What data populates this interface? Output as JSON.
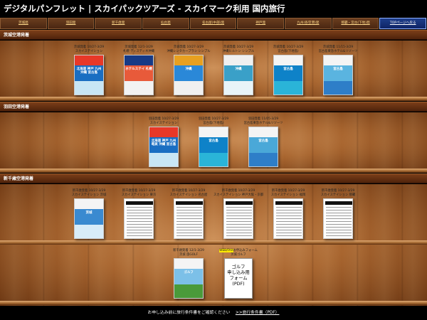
{
  "title": "デジタルパンフレット | スカイパックツアーズ - スカイマーク利用 国内旅行",
  "nav": [
    "茨城発",
    "羽田発",
    "新千歳発",
    "仙台発",
    "名古屋(中部)発",
    "神戸発",
    "九州(各空港)発",
    "那覇・宮古(下地)発",
    "TOPページへ戻る"
  ],
  "sections": [
    {
      "header": "茨城空港発着",
      "books": [
        {
          "label1": "茨城発着 10/27-3/29",
          "label2": "スカイステイション",
          "cover": {
            "top": "#e83828",
            "mid": "#1a6ec2",
            "bottom": "#c8e6f5",
            "text": "北海道 神戸 九州 沖縄 宮古島"
          }
        },
        {
          "label1": "茨城発着 12/1-3/29",
          "label2": "札幌 ディスティネ沖縄",
          "cover": {
            "top": "#163a86",
            "mid": "#e85a3a",
            "bottom": "#f2f2f2",
            "text": "ホテルステイ 札幌"
          }
        },
        {
          "label1": "茨城発着 10/27-3/29",
          "label2": "沖縄レンタカープラン シンプル",
          "cover": {
            "top": "#e8a020",
            "mid": "#2a88d8",
            "bottom": "#f0f0f0",
            "text": "沖縄"
          }
        },
        {
          "label1": "茨城発着 10/27-3/29",
          "label2": "沖縄ヒルトン シンプル",
          "cover": {
            "top": "#f0f0f0",
            "mid": "#3aa0c8",
            "bottom": "#e8f4f8",
            "text": "沖縄"
          }
        },
        {
          "label1": "茨城発着 10/27-3/29",
          "label2": "宮古島(下地島)",
          "cover": {
            "top": "#f4f4f4",
            "mid": "#0e82c8",
            "bottom": "#2ab4d8",
            "text": "宮古島"
          }
        },
        {
          "label1": "茨城発着 11/15-3/29",
          "label2": "宮古島東急ホテル&リゾーツ",
          "cover": {
            "top": "#f4f4f4",
            "mid": "#5ab4e0",
            "bottom": "#2e7ec8",
            "text": "宮古島"
          }
        }
      ]
    },
    {
      "header": "羽田空港発着",
      "books": [
        {
          "label1": "羽田発着 10/27-3/29",
          "label2": "スカイステイション",
          "cover": {
            "top": "#e83828",
            "mid": "#1a6ec2",
            "bottom": "#c8e6f5",
            "text": "北海道 神戸 九州 奄美 沖縄 宮古島"
          }
        },
        {
          "label1": "羽田発着 10/27-3/29",
          "label2": "宮古島(下地島)",
          "cover": {
            "top": "#f4f4f4",
            "mid": "#0e82c8",
            "bottom": "#2ab4d8",
            "text": "宮古島"
          }
        },
        {
          "label1": "羽田発着 11/05-3/29",
          "label2": "宮古島東急ホテル&リゾーツ",
          "cover": {
            "top": "#f4f4f4",
            "mid": "#4aa8d8",
            "bottom": "#2e7ec8",
            "text": "宮古島"
          }
        }
      ]
    },
    {
      "header": "新千歳空港発着",
      "books": [
        {
          "label1": "新千歳発着 10/27-3/29",
          "label2": "スカイステイション 茨城",
          "cover": {
            "top": "#f4f4f4",
            "mid": "#3a8ad0",
            "bottom": "#d8ecf8",
            "text": "茨城"
          }
        },
        {
          "label1": "新千歳発着 10/27-3/29",
          "label2": "スカイステイション 東京",
          "cover": {
            "doc": true
          }
        },
        {
          "label1": "新千歳発着 10/27-3/29",
          "label2": "スカイステイション 名古屋",
          "cover": {
            "doc": true
          }
        },
        {
          "label1": "新千歳発着 10/27-3/29",
          "label2": "スカイステイション 神戸大阪・京都",
          "cover": {
            "doc": true
          }
        },
        {
          "label1": "新千歳発着 10/27-3/29",
          "label2": "スカイステイション 福岡",
          "cover": {
            "doc": true
          }
        },
        {
          "label1": "新千歳発着 10/27-3/29",
          "label2": "スカイステイション 那覇",
          "cover": {
            "doc": true
          }
        }
      ]
    },
    {
      "header": "",
      "books": [
        {
          "label1": "新千歳発着 12/1-3/29",
          "label2": "茨城 旅GOLF",
          "cover": {
            "top": "#f4f4f4",
            "mid": "#7cc0e8",
            "bottom": "#4a9a3a",
            "text": "ゴルフ"
          }
        }
      ],
      "golf_form": {
        "label_highlight": "WEB/FAX",
        "label_rest": "お申込みフォーム",
        "label2": "茨城ゴルフ",
        "text": "ゴルフ 申し込み用 フォーム (PDF)"
      }
    }
  ],
  "footer": {
    "text": "お申し込み前に旅行条件書をご確認ください",
    "link": ">>旅行条件書（PDF）"
  }
}
